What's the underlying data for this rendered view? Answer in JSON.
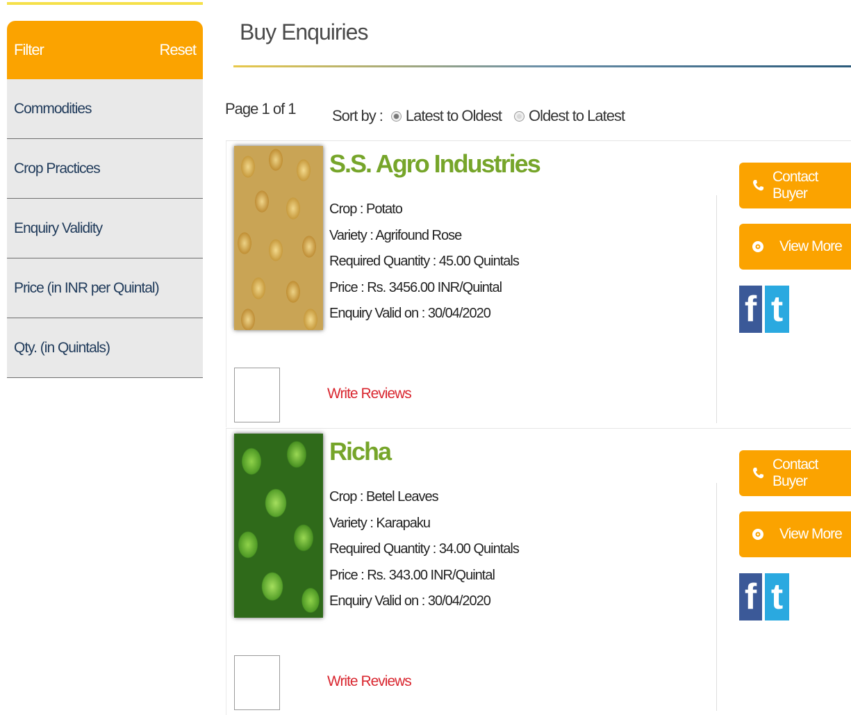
{
  "sidebar": {
    "header": {
      "title": "Filter",
      "reset_label": "Reset"
    },
    "items": [
      {
        "label": "Commodities"
      },
      {
        "label": "Crop Practices"
      },
      {
        "label": "Enquiry Validity"
      },
      {
        "label": "Price (in INR per Quintal)"
      },
      {
        "label": "Qty. (in Quintals)"
      }
    ]
  },
  "main": {
    "title": "Buy Enquiries",
    "paging": "Page 1 of 1",
    "sort": {
      "label": "Sort by :",
      "options": [
        {
          "label": "Latest to Oldest",
          "selected": true
        },
        {
          "label": "Oldest to Latest",
          "selected": false
        }
      ]
    }
  },
  "enquiries": [
    {
      "buyer": "S.S. Agro Industries",
      "image": "potato-photo",
      "crop": "Crop : Potato",
      "variety": "Variety : Agrifound Rose",
      "quantity": "Required Quantity : 45.00 Quintals",
      "price": "Price : Rs. 3456.00 INR/Quintal",
      "valid": "Enquiry Valid on : 30/04/2020",
      "review_label": "Write Reviews",
      "contact_label": "Contact Buyer",
      "view_label": "View More",
      "fb_glyph": "f",
      "tw_glyph": "t"
    },
    {
      "buyer": "Richa",
      "image": "betel-leaves-photo",
      "crop": "Crop : Betel Leaves",
      "variety": "Variety : Karapaku",
      "quantity": "Required Quantity : 34.00 Quintals",
      "price": "Price : Rs. 343.00 INR/Quintal",
      "valid": "Enquiry Valid on : 30/04/2020",
      "review_label": "Write Reviews",
      "contact_label": "Contact Buyer",
      "view_label": "View More",
      "fb_glyph": "f",
      "tw_glyph": "t"
    }
  ],
  "colors": {
    "accent": "#fba300",
    "buyer_name": "#76a52a",
    "review_link": "#d9262f",
    "facebook": "#3b5998",
    "twitter": "#2aa9e0"
  }
}
